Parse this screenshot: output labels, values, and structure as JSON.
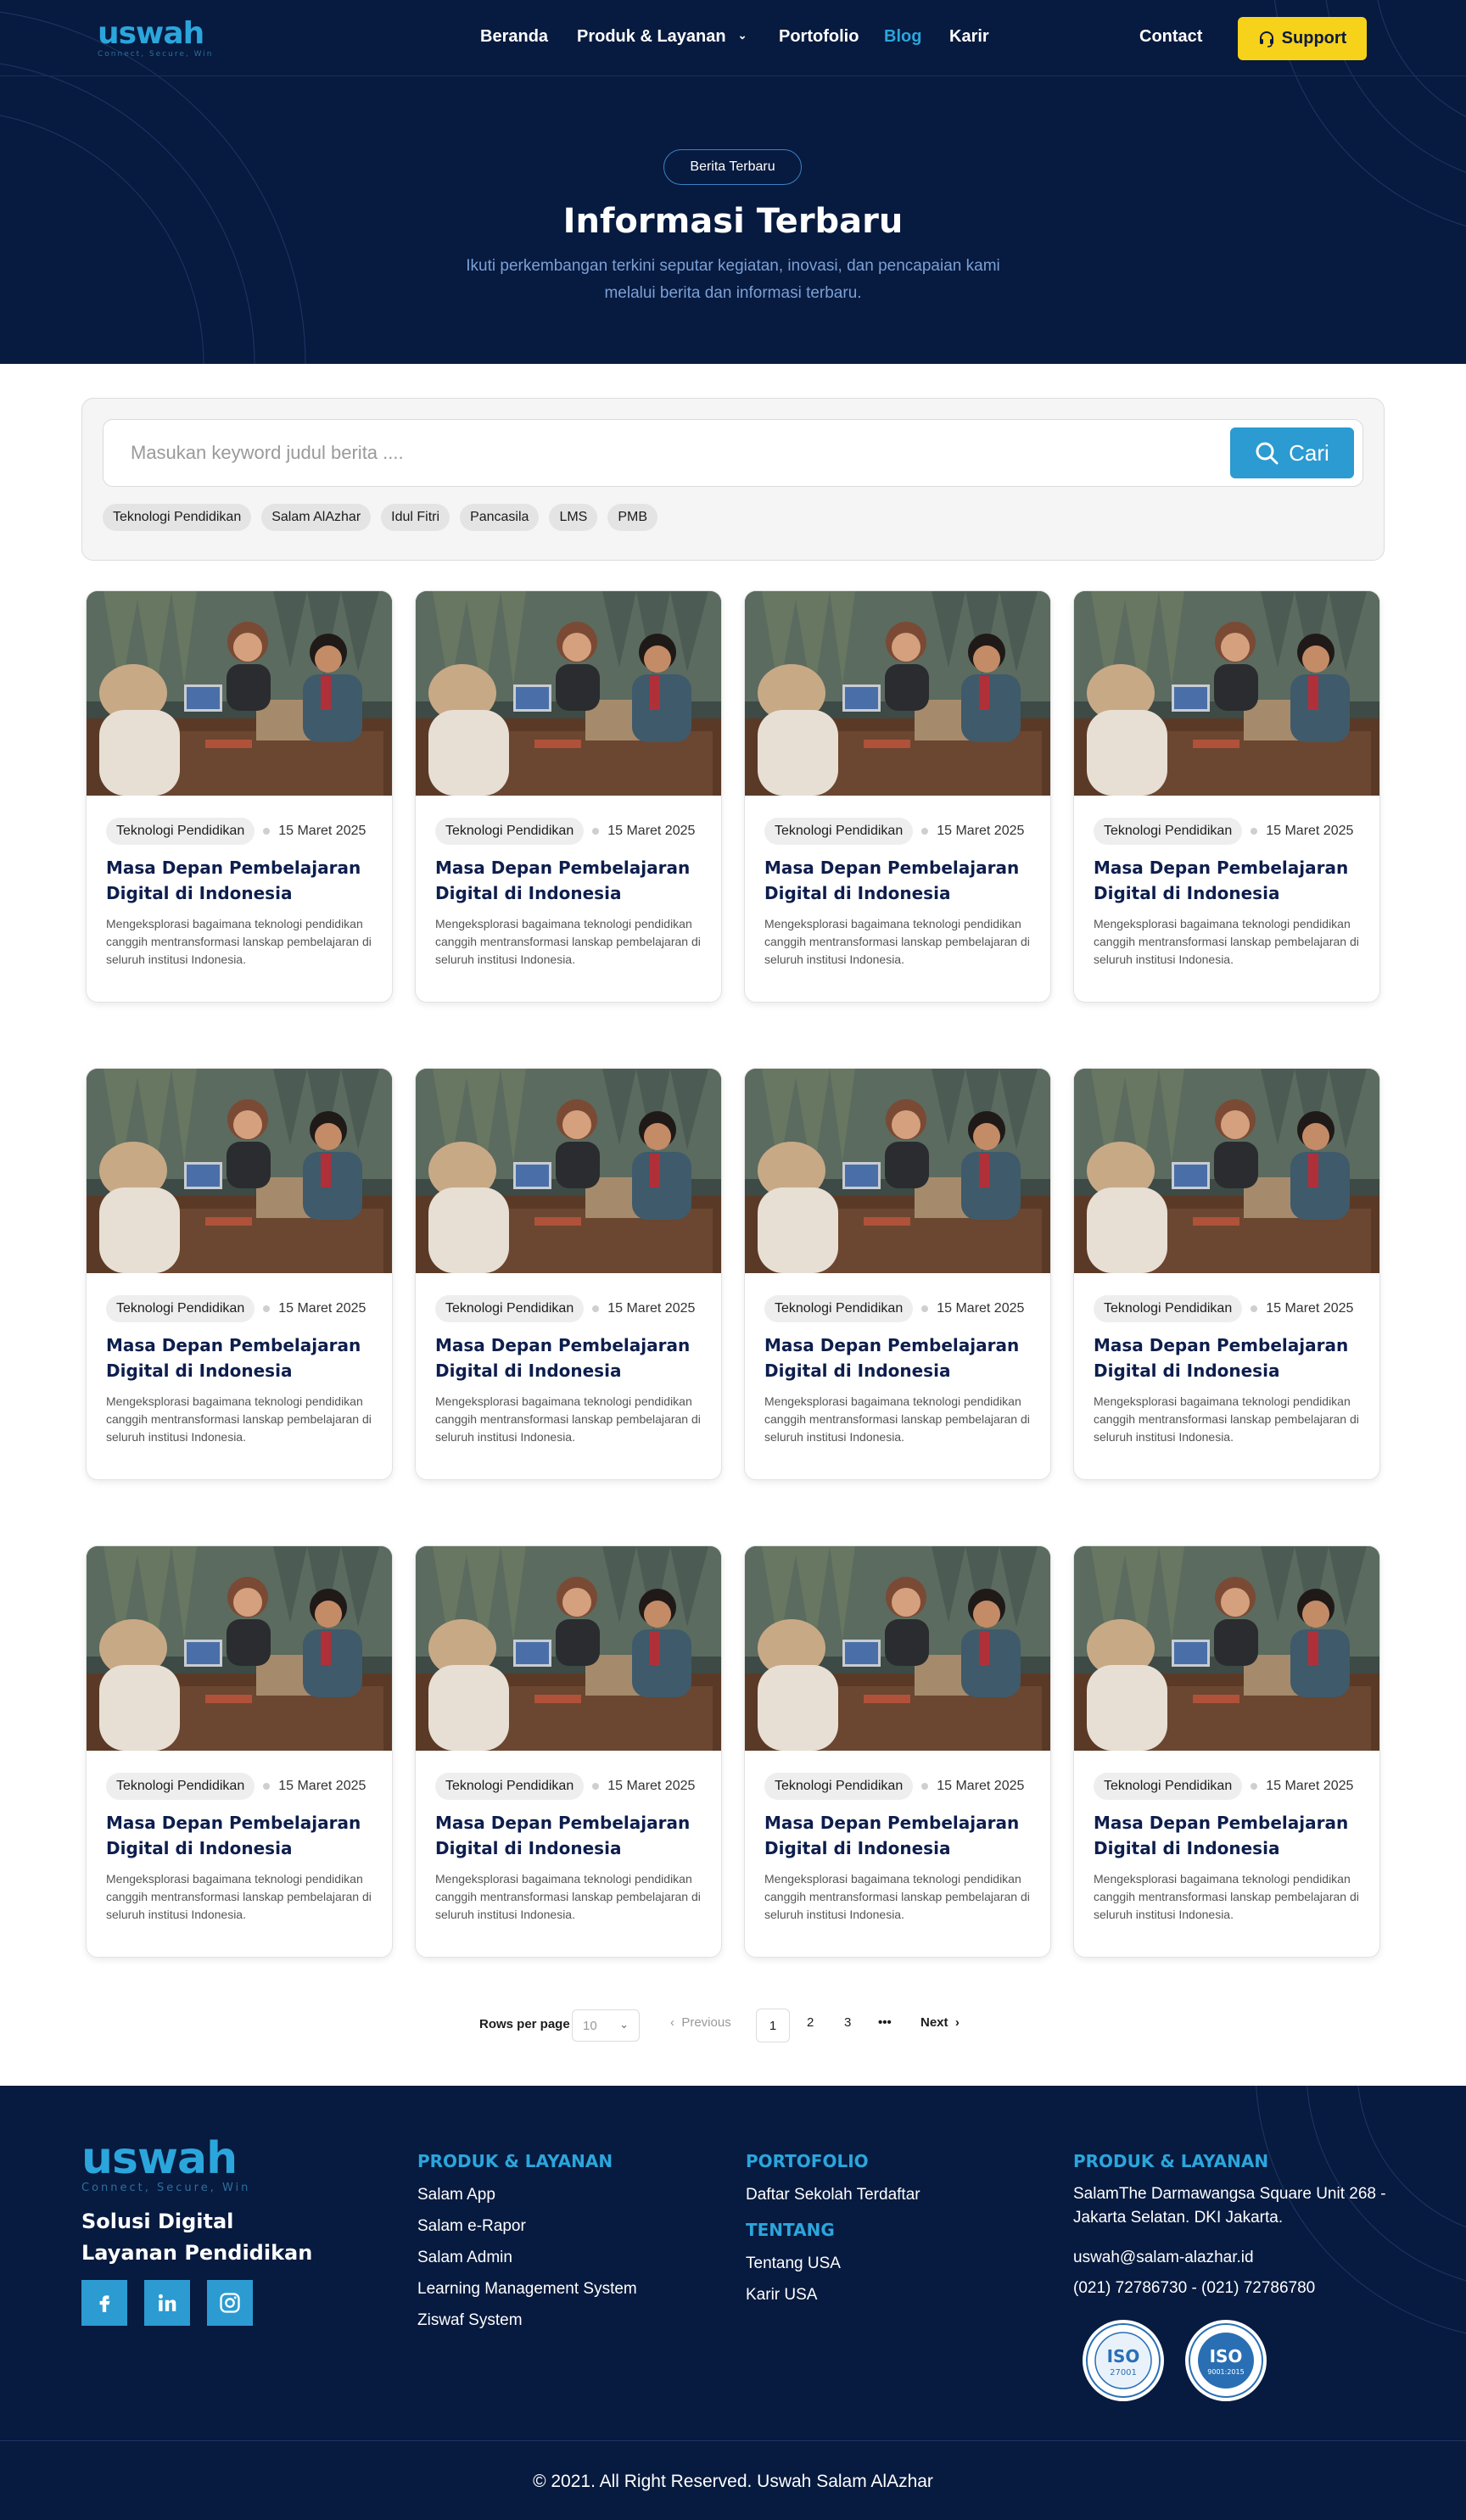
{
  "brand": {
    "name": "uswah",
    "tagline": "Connect, Secure, Win",
    "accent": "#2ba6dc",
    "navy": "#071a3f",
    "support_color": "#f7d21a"
  },
  "nav": {
    "items": [
      {
        "label": "Beranda"
      },
      {
        "label": "Produk & Layanan"
      },
      {
        "label": "Portofolio"
      },
      {
        "label": "Blog"
      },
      {
        "label": "Karir"
      }
    ],
    "active": "Blog",
    "contact": "Contact",
    "support": "Support"
  },
  "hero": {
    "badge": "Berita Terbaru",
    "title": "Informasi Terbaru",
    "subtitle": "Ikuti perkembangan terkini seputar kegiatan, inovasi, dan pencapaian kami melalui berita dan informasi terbaru."
  },
  "search": {
    "placeholder": "Masukan keyword judul berita ....",
    "button": "Cari",
    "tags": [
      "Teknologi Pendidikan",
      "Salam AlAzhar",
      "Idul Fitri",
      "Pancasila",
      "LMS",
      "PMB"
    ]
  },
  "posts": [
    {
      "category": "Teknologi Pendidikan",
      "date": "15 Maret 2025",
      "title": "Masa Depan Pembelajaran Digital di Indonesia",
      "excerpt": "Mengeksplorasi bagaimana teknologi pendidikan canggih mentransformasi lanskap pembelajaran di seluruh institusi Indonesia."
    },
    {
      "category": "Teknologi Pendidikan",
      "date": "15 Maret 2025",
      "title": "Masa Depan Pembelajaran Digital di Indonesia",
      "excerpt": "Mengeksplorasi bagaimana teknologi pendidikan canggih mentransformasi lanskap pembelajaran di seluruh institusi Indonesia."
    },
    {
      "category": "Teknologi Pendidikan",
      "date": "15 Maret 2025",
      "title": "Masa Depan Pembelajaran Digital di Indonesia",
      "excerpt": "Mengeksplorasi bagaimana teknologi pendidikan canggih mentransformasi lanskap pembelajaran di seluruh institusi Indonesia."
    },
    {
      "category": "Teknologi Pendidikan",
      "date": "15 Maret 2025",
      "title": "Masa Depan Pembelajaran Digital di Indonesia",
      "excerpt": "Mengeksplorasi bagaimana teknologi pendidikan canggih mentransformasi lanskap pembelajaran di seluruh institusi Indonesia."
    },
    {
      "category": "Teknologi Pendidikan",
      "date": "15 Maret 2025",
      "title": "Masa Depan Pembelajaran Digital di Indonesia",
      "excerpt": "Mengeksplorasi bagaimana teknologi pendidikan canggih mentransformasi lanskap pembelajaran di seluruh institusi Indonesia."
    },
    {
      "category": "Teknologi Pendidikan",
      "date": "15 Maret 2025",
      "title": "Masa Depan Pembelajaran Digital di Indonesia",
      "excerpt": "Mengeksplorasi bagaimana teknologi pendidikan canggih mentransformasi lanskap pembelajaran di seluruh institusi Indonesia."
    },
    {
      "category": "Teknologi Pendidikan",
      "date": "15 Maret 2025",
      "title": "Masa Depan Pembelajaran Digital di Indonesia",
      "excerpt": "Mengeksplorasi bagaimana teknologi pendidikan canggih mentransformasi lanskap pembelajaran di seluruh institusi Indonesia."
    },
    {
      "category": "Teknologi Pendidikan",
      "date": "15 Maret 2025",
      "title": "Masa Depan Pembelajaran Digital di Indonesia",
      "excerpt": "Mengeksplorasi bagaimana teknologi pendidikan canggih mentransformasi lanskap pembelajaran di seluruh institusi Indonesia."
    },
    {
      "category": "Teknologi Pendidikan",
      "date": "15 Maret 2025",
      "title": "Masa Depan Pembelajaran Digital di Indonesia",
      "excerpt": "Mengeksplorasi bagaimana teknologi pendidikan canggih mentransformasi lanskap pembelajaran di seluruh institusi Indonesia."
    },
    {
      "category": "Teknologi Pendidikan",
      "date": "15 Maret 2025",
      "title": "Masa Depan Pembelajaran Digital di Indonesia",
      "excerpt": "Mengeksplorasi bagaimana teknologi pendidikan canggih mentransformasi lanskap pembelajaran di seluruh institusi Indonesia."
    },
    {
      "category": "Teknologi Pendidikan",
      "date": "15 Maret 2025",
      "title": "Masa Depan Pembelajaran Digital di Indonesia",
      "excerpt": "Mengeksplorasi bagaimana teknologi pendidikan canggih mentransformasi lanskap pembelajaran di seluruh institusi Indonesia."
    },
    {
      "category": "Teknologi Pendidikan",
      "date": "15 Maret 2025",
      "title": "Masa Depan Pembelajaran Digital di Indonesia",
      "excerpt": "Mengeksplorasi bagaimana teknologi pendidikan canggih mentransformasi lanskap pembelajaran di seluruh institusi Indonesia."
    }
  ],
  "pagination": {
    "rows_label": "Rows per page",
    "rows_value": "10",
    "previous": "Previous",
    "pages": [
      "1",
      "2",
      "3"
    ],
    "ellipsis": "•••",
    "next": "Next",
    "current": "1"
  },
  "footer": {
    "tagline": "Solusi Digital Layanan Pendidikan",
    "social": [
      "facebook-icon",
      "linkedin-icon",
      "instagram-icon"
    ],
    "col_products": {
      "heading": "PRODUK & LAYANAN",
      "links": [
        "Salam App",
        "Salam e-Rapor",
        "Salam Admin",
        "Learning Management System",
        "Ziswaf System"
      ]
    },
    "col_portfolio": {
      "heading": "PORTOFOLIO",
      "links": [
        "Daftar Sekolah Terdaftar"
      ]
    },
    "col_about": {
      "heading": "TENTANG",
      "links": [
        "Tentang USA",
        "Karir USA"
      ]
    },
    "col_contact": {
      "heading": "PRODUK & LAYANAN",
      "address": "SalamThe Darmawangsa Square Unit 268 - Jakarta Selatan. DKI Jakarta.",
      "email": "uswah@salam-alazhar.id",
      "phone": "(021) 72786730 - (021) 72786780"
    },
    "certs": [
      {
        "label": "ISO",
        "number": "27001"
      },
      {
        "label": "ISO",
        "number": "9001:2015"
      }
    ],
    "copyright": "© 2021. All Right Reserved. Uswah Salam AlAzhar"
  }
}
